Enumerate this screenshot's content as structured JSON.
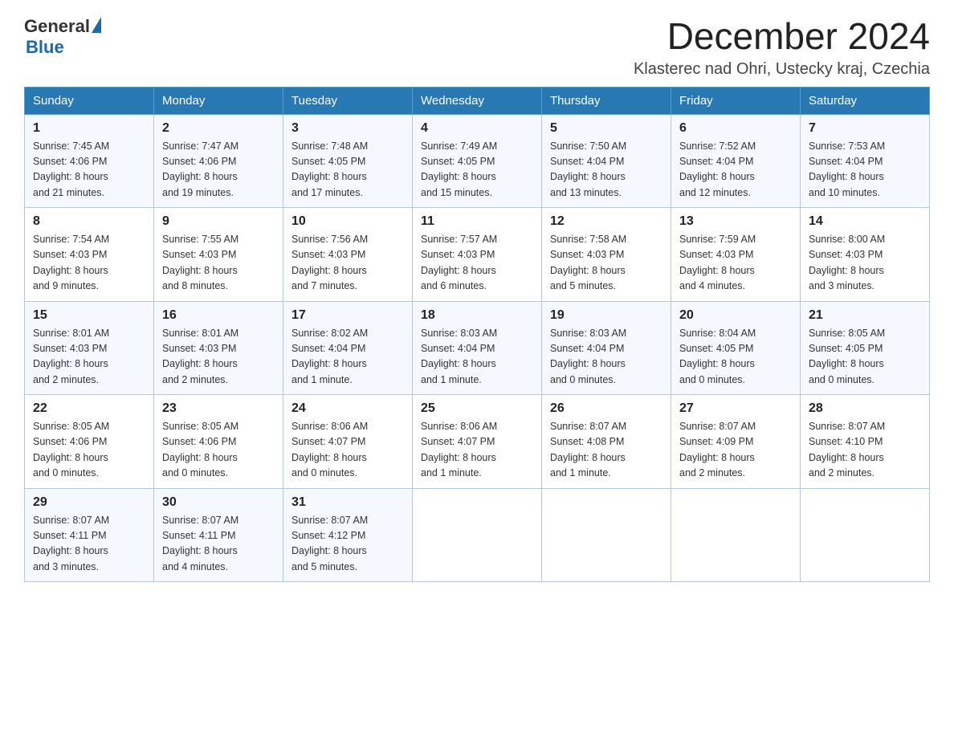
{
  "header": {
    "logo": {
      "text_general": "General",
      "text_blue": "Blue",
      "alt": "GeneralBlue logo"
    },
    "title": "December 2024",
    "location": "Klasterec nad Ohri, Ustecky kraj, Czechia"
  },
  "days_of_week": [
    "Sunday",
    "Monday",
    "Tuesday",
    "Wednesday",
    "Thursday",
    "Friday",
    "Saturday"
  ],
  "weeks": [
    [
      {
        "day": "1",
        "sunrise": "7:45 AM",
        "sunset": "4:06 PM",
        "daylight": "8 hours and 21 minutes."
      },
      {
        "day": "2",
        "sunrise": "7:47 AM",
        "sunset": "4:06 PM",
        "daylight": "8 hours and 19 minutes."
      },
      {
        "day": "3",
        "sunrise": "7:48 AM",
        "sunset": "4:05 PM",
        "daylight": "8 hours and 17 minutes."
      },
      {
        "day": "4",
        "sunrise": "7:49 AM",
        "sunset": "4:05 PM",
        "daylight": "8 hours and 15 minutes."
      },
      {
        "day": "5",
        "sunrise": "7:50 AM",
        "sunset": "4:04 PM",
        "daylight": "8 hours and 13 minutes."
      },
      {
        "day": "6",
        "sunrise": "7:52 AM",
        "sunset": "4:04 PM",
        "daylight": "8 hours and 12 minutes."
      },
      {
        "day": "7",
        "sunrise": "7:53 AM",
        "sunset": "4:04 PM",
        "daylight": "8 hours and 10 minutes."
      }
    ],
    [
      {
        "day": "8",
        "sunrise": "7:54 AM",
        "sunset": "4:03 PM",
        "daylight": "8 hours and 9 minutes."
      },
      {
        "day": "9",
        "sunrise": "7:55 AM",
        "sunset": "4:03 PM",
        "daylight": "8 hours and 8 minutes."
      },
      {
        "day": "10",
        "sunrise": "7:56 AM",
        "sunset": "4:03 PM",
        "daylight": "8 hours and 7 minutes."
      },
      {
        "day": "11",
        "sunrise": "7:57 AM",
        "sunset": "4:03 PM",
        "daylight": "8 hours and 6 minutes."
      },
      {
        "day": "12",
        "sunrise": "7:58 AM",
        "sunset": "4:03 PM",
        "daylight": "8 hours and 5 minutes."
      },
      {
        "day": "13",
        "sunrise": "7:59 AM",
        "sunset": "4:03 PM",
        "daylight": "8 hours and 4 minutes."
      },
      {
        "day": "14",
        "sunrise": "8:00 AM",
        "sunset": "4:03 PM",
        "daylight": "8 hours and 3 minutes."
      }
    ],
    [
      {
        "day": "15",
        "sunrise": "8:01 AM",
        "sunset": "4:03 PM",
        "daylight": "8 hours and 2 minutes."
      },
      {
        "day": "16",
        "sunrise": "8:01 AM",
        "sunset": "4:03 PM",
        "daylight": "8 hours and 2 minutes."
      },
      {
        "day": "17",
        "sunrise": "8:02 AM",
        "sunset": "4:04 PM",
        "daylight": "8 hours and 1 minute."
      },
      {
        "day": "18",
        "sunrise": "8:03 AM",
        "sunset": "4:04 PM",
        "daylight": "8 hours and 1 minute."
      },
      {
        "day": "19",
        "sunrise": "8:03 AM",
        "sunset": "4:04 PM",
        "daylight": "8 hours and 0 minutes."
      },
      {
        "day": "20",
        "sunrise": "8:04 AM",
        "sunset": "4:05 PM",
        "daylight": "8 hours and 0 minutes."
      },
      {
        "day": "21",
        "sunrise": "8:05 AM",
        "sunset": "4:05 PM",
        "daylight": "8 hours and 0 minutes."
      }
    ],
    [
      {
        "day": "22",
        "sunrise": "8:05 AM",
        "sunset": "4:06 PM",
        "daylight": "8 hours and 0 minutes."
      },
      {
        "day": "23",
        "sunrise": "8:05 AM",
        "sunset": "4:06 PM",
        "daylight": "8 hours and 0 minutes."
      },
      {
        "day": "24",
        "sunrise": "8:06 AM",
        "sunset": "4:07 PM",
        "daylight": "8 hours and 0 minutes."
      },
      {
        "day": "25",
        "sunrise": "8:06 AM",
        "sunset": "4:07 PM",
        "daylight": "8 hours and 1 minute."
      },
      {
        "day": "26",
        "sunrise": "8:07 AM",
        "sunset": "4:08 PM",
        "daylight": "8 hours and 1 minute."
      },
      {
        "day": "27",
        "sunrise": "8:07 AM",
        "sunset": "4:09 PM",
        "daylight": "8 hours and 2 minutes."
      },
      {
        "day": "28",
        "sunrise": "8:07 AM",
        "sunset": "4:10 PM",
        "daylight": "8 hours and 2 minutes."
      }
    ],
    [
      {
        "day": "29",
        "sunrise": "8:07 AM",
        "sunset": "4:11 PM",
        "daylight": "8 hours and 3 minutes."
      },
      {
        "day": "30",
        "sunrise": "8:07 AM",
        "sunset": "4:11 PM",
        "daylight": "8 hours and 4 minutes."
      },
      {
        "day": "31",
        "sunrise": "8:07 AM",
        "sunset": "4:12 PM",
        "daylight": "8 hours and 5 minutes."
      },
      null,
      null,
      null,
      null
    ]
  ],
  "labels": {
    "sunrise": "Sunrise:",
    "sunset": "Sunset:",
    "daylight": "Daylight:"
  }
}
